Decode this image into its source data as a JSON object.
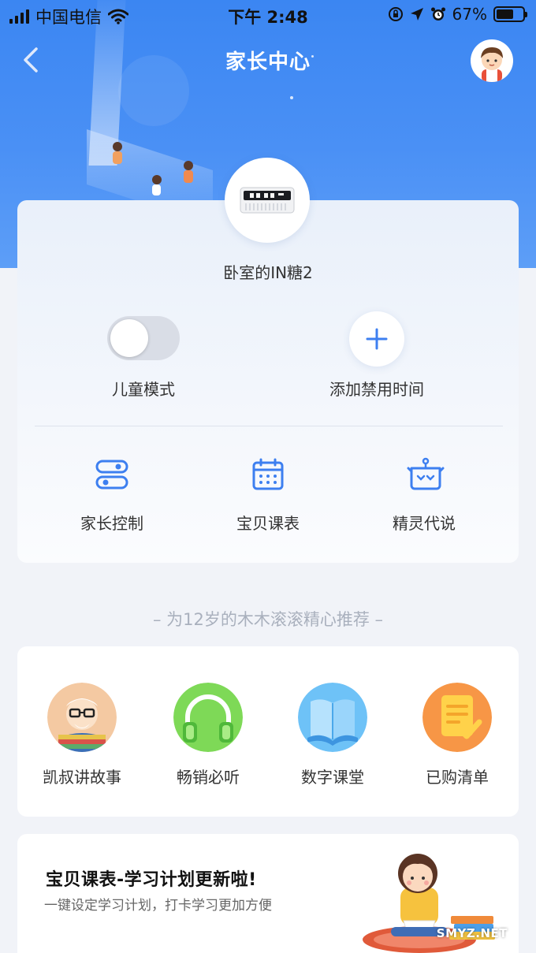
{
  "status_bar": {
    "carrier": "中国电信",
    "time": "下午 2:48",
    "battery_percent": "67%",
    "battery_level": 0.67,
    "icons": [
      "signal-icon",
      "wifi-icon",
      "screen-rotation-lock-icon",
      "location-icon",
      "alarm-icon",
      "battery-icon"
    ]
  },
  "nav": {
    "title": "家长中心",
    "back_icon": "chevron-left-icon",
    "avatar_icon": "child-avatar-icon"
  },
  "device": {
    "name": "卧室的IN糖2",
    "image_icon": "alarm-clock-speaker-icon"
  },
  "controls": {
    "child_mode_label": "儿童模式",
    "child_mode_on": false,
    "add_forbidden_time_label": "添加禁用时间",
    "add_icon": "plus-icon"
  },
  "tools": [
    {
      "label": "家长控制",
      "icon": "toggle-switches-icon"
    },
    {
      "label": "宝贝课表",
      "icon": "calendar-icon"
    },
    {
      "label": "精灵代说",
      "icon": "robot-icon"
    }
  ],
  "recommend": {
    "title": "– 为12岁的木木滚滚精心推荐 –",
    "items": [
      {
        "label": "凯叔讲故事",
        "icon": "storyteller-icon"
      },
      {
        "label": "畅销必听",
        "icon": "headphones-icon"
      },
      {
        "label": "数字课堂",
        "icon": "book-icon"
      },
      {
        "label": "已购清单",
        "icon": "checklist-icon"
      }
    ]
  },
  "banner": {
    "title": "宝贝课表-学习计划更新啦!",
    "subtitle": "一键设定学习计划，打卡学习更加方便",
    "illustration": "girl-reading-icon",
    "watermark": "SMYZ.NET"
  },
  "colors": {
    "header_blue": "#3b86f2",
    "accent_blue": "#3d7ff0",
    "page_bg": "#f1f3f8"
  }
}
